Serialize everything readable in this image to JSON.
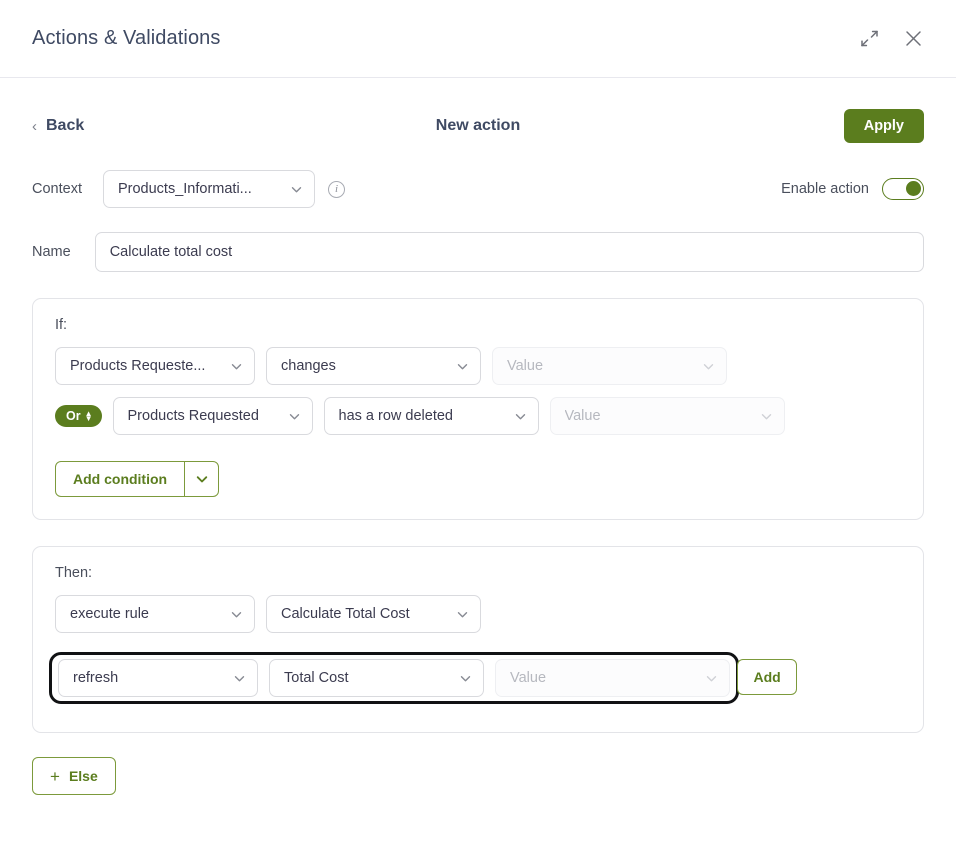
{
  "window": {
    "title": "Actions & Validations",
    "expand_icon": "expand-diagonal-icon",
    "close_icon": "close-icon"
  },
  "nav": {
    "back_label": "Back",
    "back_chevron": "‹",
    "title": "New action",
    "apply_label": "Apply"
  },
  "context": {
    "label": "Context",
    "value": "Products_Informati...",
    "info_icon": "info-icon",
    "enable_label": "Enable action",
    "enable_state": "on"
  },
  "name": {
    "label": "Name",
    "value": "Calculate total cost",
    "placeholder": "Name"
  },
  "if_block": {
    "legend": "If:",
    "conditions": [
      {
        "connector": null,
        "subject": "Products Requeste...",
        "operator": "changes",
        "value": "",
        "value_placeholder": "Value",
        "value_disabled": true
      },
      {
        "connector": "Or",
        "subject": "Products Requested",
        "operator": "has a row deleted",
        "value": "",
        "value_placeholder": "Value",
        "value_disabled": true
      }
    ],
    "add_condition_label": "Add condition"
  },
  "then_block": {
    "legend": "Then:",
    "actions": [
      {
        "operation": "execute rule",
        "target": "Calculate Total Cost",
        "value": null,
        "highlighted": false
      },
      {
        "operation": "refresh",
        "target": "Total Cost",
        "value": "",
        "value_placeholder": "Value",
        "value_disabled": true,
        "highlighted": true
      }
    ],
    "add_label": "Add"
  },
  "else_block": {
    "label": "Else",
    "plus": "+"
  },
  "colors": {
    "accent_green": "#5b7d1e",
    "border_green": "#7c9a3b",
    "text_primary": "#3b3b4f",
    "text_muted": "#b6b8bf",
    "border": "#d9dade",
    "highlight_ring": "#111214"
  }
}
